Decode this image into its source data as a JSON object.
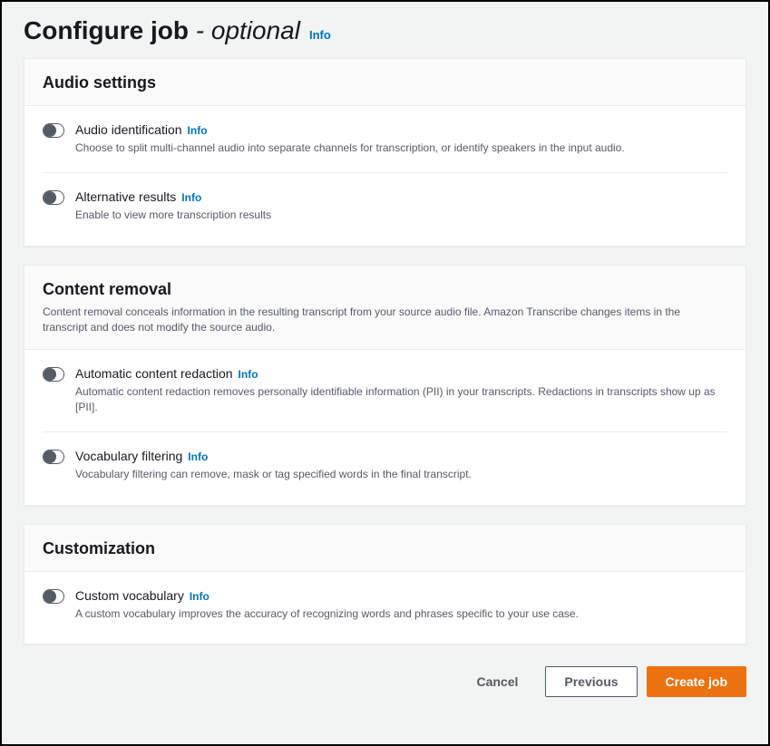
{
  "header": {
    "title_main": "Configure job ",
    "title_em": "- optional",
    "info": "Info"
  },
  "panels": {
    "audio": {
      "title": "Audio settings",
      "items": {
        "audio_id": {
          "label": "Audio identification",
          "info": "Info",
          "desc": "Choose to split multi-channel audio into separate channels for transcription, or identify speakers in the input audio."
        },
        "alt_results": {
          "label": "Alternative results",
          "info": "Info",
          "desc": "Enable to view more transcription results"
        }
      }
    },
    "content": {
      "title": "Content removal",
      "desc": "Content removal conceals information in the resulting transcript from your source audio file. Amazon Transcribe changes items in the transcript and does not modify the source audio.",
      "items": {
        "redaction": {
          "label": "Automatic content redaction",
          "info": "Info",
          "desc": "Automatic content redaction removes personally identifiable information (PII) in your transcripts. Redactions in transcripts show up as [PII]."
        },
        "vocab_filter": {
          "label": "Vocabulary filtering",
          "info": "Info",
          "desc": "Vocabulary filtering can remove, mask or tag specified words in the final transcript."
        }
      }
    },
    "custom": {
      "title": "Customization",
      "items": {
        "custom_vocab": {
          "label": "Custom vocabulary",
          "info": "Info",
          "desc": "A custom vocabulary improves the accuracy of recognizing words and phrases specific to your use case."
        }
      }
    }
  },
  "footer": {
    "cancel": "Cancel",
    "previous": "Previous",
    "create": "Create job"
  }
}
